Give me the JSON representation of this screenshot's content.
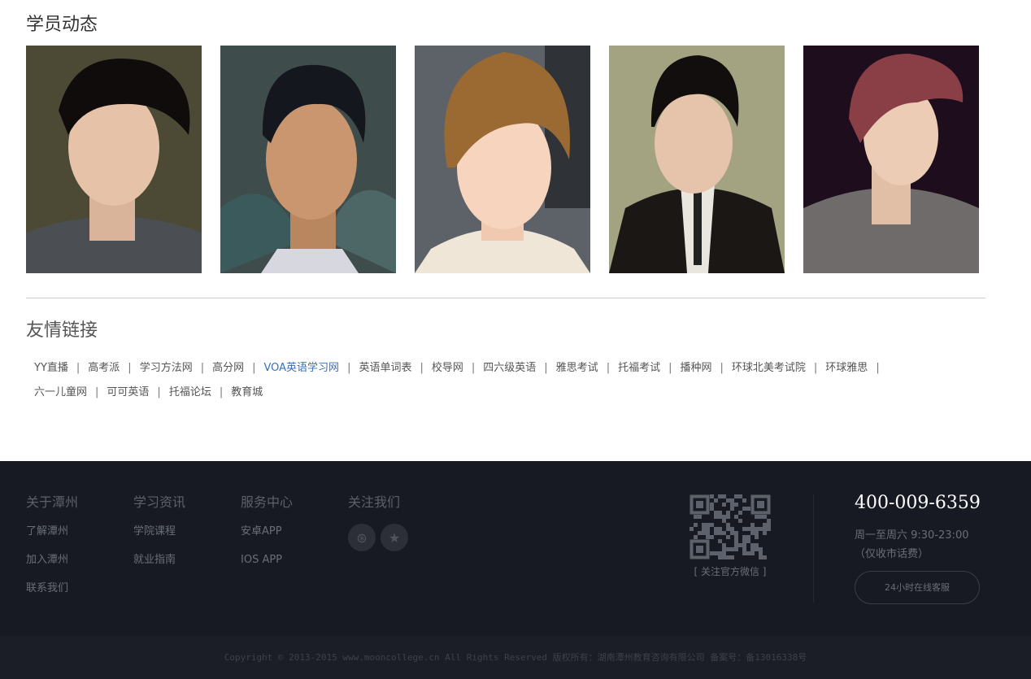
{
  "students": {
    "title": "学员动态",
    "photos": [
      {
        "name": "student-photo-1"
      },
      {
        "name": "student-photo-2"
      },
      {
        "name": "student-photo-3"
      },
      {
        "name": "student-photo-4"
      },
      {
        "name": "student-photo-5"
      }
    ]
  },
  "links": {
    "title": "友情链接",
    "items": [
      "YY直播",
      "高考派",
      "学习方法网",
      "高分网",
      "VOA英语学习网",
      "英语单词表",
      "校导网",
      "四六级英语",
      "雅思考试",
      "托福考试",
      "播种网",
      "环球北美考试院",
      "环球雅思",
      "六一儿童网",
      "可可英语",
      "托福论坛",
      "教育城"
    ],
    "separator": "|",
    "active_index": 4,
    "active_color": "#3a6fb7"
  },
  "footer": {
    "about": {
      "title": "关于潭州",
      "items": [
        "了解潭州",
        "加入潭州",
        "联系我们"
      ]
    },
    "news": {
      "title": "学习资讯",
      "items": [
        "学院课程",
        "就业指南"
      ]
    },
    "service": {
      "title": "服务中心",
      "items": [
        "安卓APP",
        "IOS APP"
      ]
    },
    "follow": {
      "title": "关注我们",
      "icons": [
        "weibo-icon",
        "star-icon"
      ]
    },
    "qr_label": "[ 关注官方微信 ]",
    "phone": "400-009-6359",
    "hours": "周一至周六 9:30-23:00",
    "hours_note": "（仅收市话费）",
    "service_button": "24小时在线客服",
    "copyright": "Copyright © 2013-2015 www.mooncollege.cn All Rights Reserved 版权所有：湖南潭州教育咨询有限公司 备案号：备13016338号",
    "bg_color": "#171a22"
  }
}
